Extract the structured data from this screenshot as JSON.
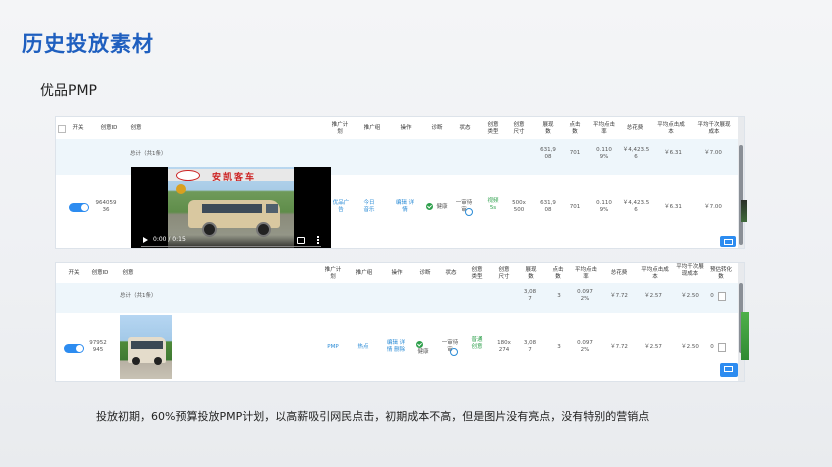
{
  "slide": {
    "title": "历史投放素材",
    "subtitle": "优品PMP",
    "caption": "投放初期，60%预算投放PMP计划，以高薪吸引网民点击，初期成本不高，但是图片没有亮点，没有特别的营销点"
  },
  "colors": {
    "title": "#1f5fbf",
    "toggle": "#2d8cf0",
    "link": "#2a8bd6",
    "ok": "#2ea04c",
    "summary_bg": "#eef6fb"
  },
  "table1": {
    "headers": [
      "开关",
      "创意ID",
      "创意",
      "推广计划",
      "推广组",
      "操作",
      "诊断",
      "状态",
      "创意类型",
      "创意尺寸",
      "展现数",
      "点击数",
      "平均点击率",
      "总花费",
      "平均点击成本",
      "平均千次展现成本"
    ],
    "summary": {
      "label": "总计（共1条）",
      "impressions": "631,908",
      "clicks": "701",
      "ctr": "0.1109%",
      "cost": "￥4,423.56",
      "cpc": "￥6.31",
      "cpm": "￥7.00"
    },
    "row": {
      "id": "96405936",
      "video_banner": "安凯客车",
      "video_time": "0:00 / 0:15",
      "plan": "优品广告",
      "group": "今日音乐",
      "ops": "编辑 详情",
      "diagnosis": "健康",
      "status": "一审待审",
      "creative_type": "视频 5s",
      "size": "500x500",
      "impressions": "631,908",
      "clicks": "701",
      "ctr": "0.1109%",
      "cost": "￥4,423.56",
      "cpc": "￥6.31",
      "cpm": "￥7.00"
    }
  },
  "table2": {
    "headers": [
      "开关",
      "创意ID",
      "创意",
      "推广计划",
      "推广组",
      "操作",
      "诊断",
      "状态",
      "创意类型",
      "创意尺寸",
      "展现数",
      "点击数",
      "平均点击率",
      "总花费",
      "平均点击成本",
      "平均千次展现成本",
      "预估转化数"
    ],
    "summary": {
      "label": "总计（共1条）",
      "impressions": "3,087",
      "clicks": "3",
      "ctr": "0.0972%",
      "cost": "￥7.72",
      "cpc": "￥2.57",
      "cpm": "￥2.50",
      "conv": "0"
    },
    "row": {
      "id": "97952945",
      "plan": "PMP",
      "group": "热点",
      "ops": "编辑 详情 删除",
      "diagnosis": "健康",
      "status": "一审待审",
      "creative_type": "普通创意",
      "size": "180x274",
      "impressions": "3,087",
      "clicks": "3",
      "ctr": "0.0972%",
      "cost": "￥7.72",
      "cpc": "￥2.57",
      "cpm": "￥2.50",
      "conv": "0"
    }
  }
}
